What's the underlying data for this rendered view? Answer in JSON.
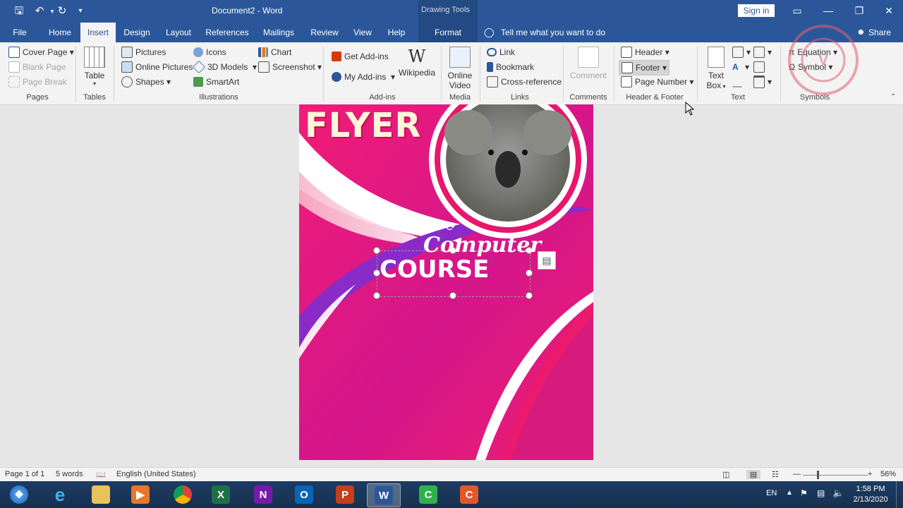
{
  "window": {
    "title": "Document2  -  Word",
    "context_group": "Drawing Tools",
    "sign_in": "Sign in",
    "share": "Share"
  },
  "tabs": [
    "File",
    "Home",
    "Insert",
    "Design",
    "Layout",
    "References",
    "Mailings",
    "Review",
    "View",
    "Help",
    "Format"
  ],
  "active_tab": "Insert",
  "tell_me": "Tell me what you want to do",
  "ribbon": {
    "pages": {
      "cover": "Cover Page",
      "blank": "Blank Page",
      "break": "Page Break",
      "label": "Pages"
    },
    "tables": {
      "table": "Table",
      "label": "Tables"
    },
    "illustrations": {
      "pictures": "Pictures",
      "online_pictures": "Online Pictures",
      "shapes": "Shapes",
      "icons": "Icons",
      "models": "3D Models",
      "smartart": "SmartArt",
      "chart": "Chart",
      "screenshot": "Screenshot",
      "label": "Illustrations"
    },
    "addins": {
      "get": "Get Add-ins",
      "my": "My Add-ins",
      "wikipedia": "Wikipedia",
      "label": "Add-ins"
    },
    "media": {
      "online_video_1": "Online",
      "online_video_2": "Video",
      "label": "Media"
    },
    "links": {
      "link": "Link",
      "bookmark": "Bookmark",
      "cross": "Cross-reference",
      "label": "Links"
    },
    "comments": {
      "comment": "Comment",
      "label": "Comments"
    },
    "header_footer": {
      "header": "Header",
      "footer": "Footer",
      "page_number": "Page Number",
      "label": "Header & Footer"
    },
    "text": {
      "textbox_1": "Text",
      "textbox_2": "Box",
      "label": "Text"
    },
    "symbols": {
      "equation": "Equation",
      "symbol": "Symbol",
      "label": "Symbols"
    }
  },
  "flyer": {
    "title": "FLYER",
    "line1": "Computer",
    "line2": "COURSE",
    "colors": {
      "magenta": "#e8166b",
      "purple": "#8a2be2",
      "white": "#ffffff"
    }
  },
  "status": {
    "page": "Page 1 of 1",
    "words": "5 words",
    "language": "English (United States)",
    "zoom": "56%"
  },
  "taskbar": {
    "lang": "EN",
    "time": "1:58 PM",
    "date": "2/13/2020",
    "apps": [
      "start-orb-icon",
      "internet-explorer-icon",
      "file-explorer-icon",
      "media-player-icon",
      "chrome-icon",
      "excel-icon",
      "onenote-icon",
      "outlook-icon",
      "powerpoint-icon",
      "word-icon",
      "camtasia-recorder-icon",
      "camtasia-icon"
    ]
  }
}
